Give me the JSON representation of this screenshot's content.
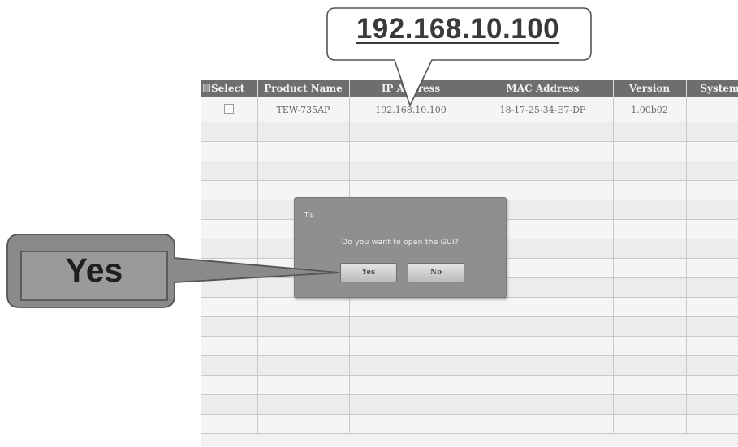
{
  "table": {
    "columns": [
      {
        "key": "select",
        "label": "Select"
      },
      {
        "key": "product",
        "label": "Product Name"
      },
      {
        "key": "ip",
        "label": "IP Address"
      },
      {
        "key": "mac",
        "label": "MAC Address"
      },
      {
        "key": "version",
        "label": "Version"
      },
      {
        "key": "system",
        "label": "System"
      }
    ],
    "rows": [
      {
        "product": "TEW-735AP",
        "ip": "192.168.10.100",
        "mac": "18-17-25-34-E7-DF",
        "version": "1.00b02",
        "system": ""
      }
    ],
    "empty_row_count": 16
  },
  "dialog": {
    "title": "Tip",
    "message": "Do you want to open the GUI?",
    "yes_label": "Yes",
    "no_label": "No"
  },
  "callouts": {
    "ip_text": "192.168.10.100",
    "yes_text": "Yes"
  },
  "colors": {
    "header_bg": "#6e6e6e",
    "dialog_bg": "#8f8f8f",
    "callout_border": "#555555",
    "callout_fill": "#8a8a8a"
  }
}
